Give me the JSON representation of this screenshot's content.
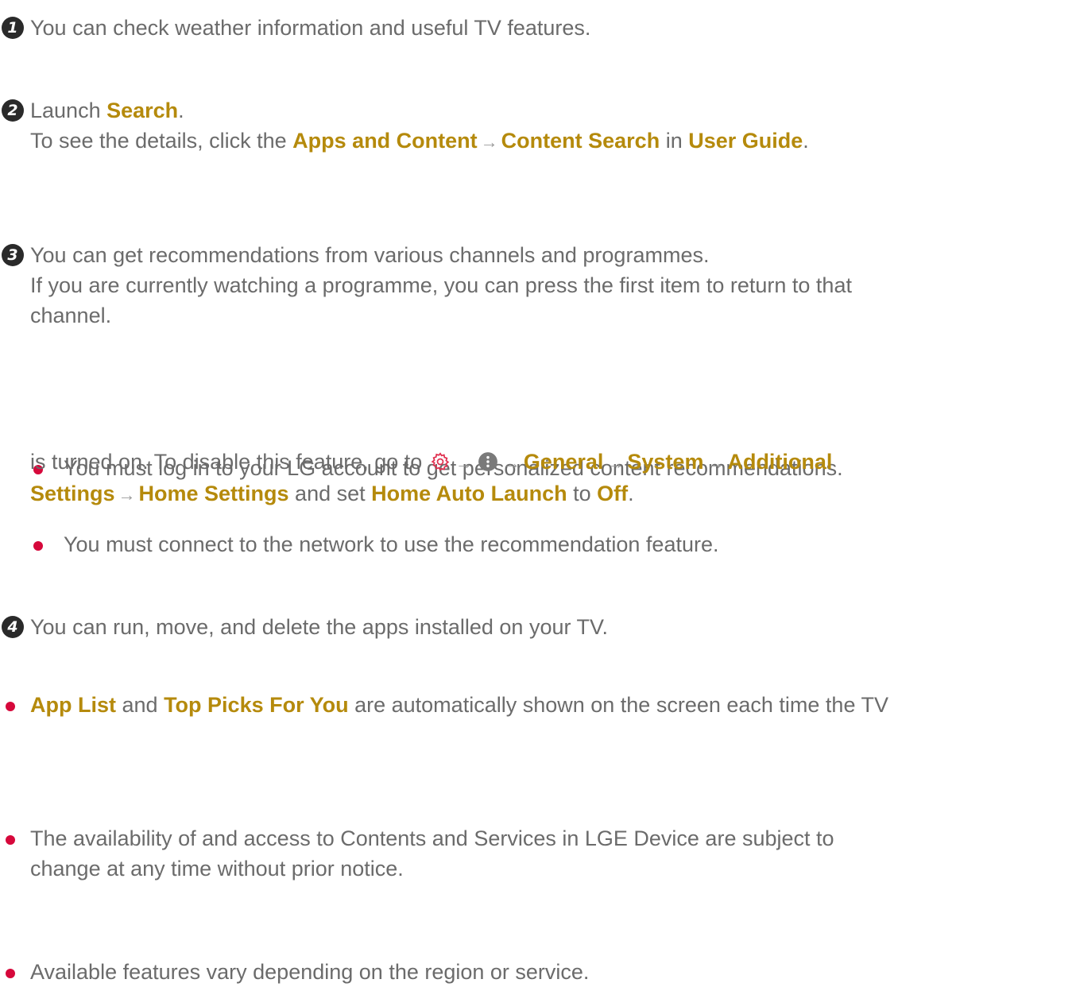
{
  "items": {
    "one": {
      "badge": "1",
      "text": "You can check weather information and useful TV features."
    },
    "two": {
      "badge": "2",
      "launch_prefix": "Launch ",
      "search": "Search",
      "launch_suffix": ".",
      "details_prefix": "To see the details, click the ",
      "apps_and_content": "Apps and Content",
      "content_search": "Content Search",
      "details_in": " in ",
      "user_guide": "User Guide",
      "details_suffix": "."
    },
    "three": {
      "badge": "3",
      "line1": "You can get recommendations from various channels and programmes.",
      "line2": "If you are currently watching a programme, you can press the first item to return to that",
      "line3": "channel.",
      "bullets": [
        "You must log in to your LG account to get personalized content recommendations.",
        "You must connect to the network to use the recommendation feature."
      ]
    },
    "four": {
      "badge": "4",
      "text": "You can run, move, and delete the apps installed on your TV."
    }
  },
  "notes": {
    "note1": {
      "app_list": "App List",
      "and": " and ",
      "top_picks": "Top Picks For You",
      "rest1": " are automatically shown on the screen each time the TV",
      "line2_prefix": "is turned on. To disable this feature, go to ",
      "general": "General",
      "system": "System",
      "additional": "Additional",
      "settings": "Settings",
      "home_settings": "Home Settings",
      "and_set": " and set ",
      "home_auto_launch": "Home Auto Launch",
      "to": " to ",
      "off": "Off",
      "period": "."
    },
    "note2": {
      "line1": "The availability of and access to Contents and Services in LGE Device are subject to",
      "line2": "change at any time without prior notice."
    },
    "note3": {
      "text": "Available features vary depending on the region or service."
    }
  },
  "icons": {
    "arrow": "→",
    "gear": "settings-gear-icon",
    "menu": "more-dots-icon"
  },
  "colors": {
    "text": "#6b6b6b",
    "highlight": "#b58a0c",
    "bullet": "#d6083b",
    "badge": "#2a2a2a",
    "gear": "#e0304f"
  }
}
